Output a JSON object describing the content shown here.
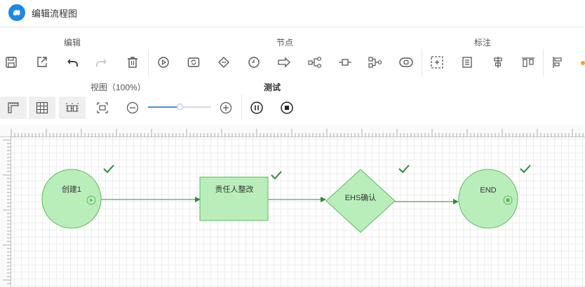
{
  "app": {
    "title": "编辑流程图",
    "accent": "#1e88e5"
  },
  "toolbar": {
    "groups": {
      "edit": "编辑",
      "node": "节点",
      "annotate": "标注"
    },
    "buttons": [
      {
        "name": "save-button",
        "icon": "save-icon",
        "enabled": true
      },
      {
        "name": "export-button",
        "icon": "export-icon",
        "enabled": true
      },
      {
        "name": "undo-button",
        "icon": "undo-icon",
        "enabled": true
      },
      {
        "name": "redo-button",
        "icon": "redo-icon",
        "enabled": false
      },
      {
        "name": "delete-button",
        "icon": "trash-icon",
        "enabled": true
      },
      {
        "name": "start-node-button",
        "icon": "play-circle-icon",
        "enabled": true
      },
      {
        "name": "loop-node-button",
        "icon": "loop-icon",
        "enabled": true
      },
      {
        "name": "decision-node-button",
        "icon": "diamond-icon",
        "enabled": true
      },
      {
        "name": "timer-node-button",
        "icon": "clock-icon",
        "enabled": true
      },
      {
        "name": "arrow-node-button",
        "icon": "arrow-right-icon",
        "enabled": true
      },
      {
        "name": "fork-node-button",
        "icon": "fork-icon",
        "enabled": true
      },
      {
        "name": "task-node-button",
        "icon": "task-icon",
        "enabled": true
      },
      {
        "name": "join-node-button",
        "icon": "join-icon",
        "enabled": true
      },
      {
        "name": "end-node-button",
        "icon": "stop-capsule-icon",
        "enabled": true
      },
      {
        "name": "select-area-button",
        "icon": "select-area-icon",
        "enabled": true
      },
      {
        "name": "note-button",
        "icon": "document-icon",
        "enabled": true
      },
      {
        "name": "align-middle-button",
        "icon": "align-middle-icon",
        "enabled": true
      },
      {
        "name": "align-bottom-button",
        "icon": "align-bottom-icon",
        "enabled": true
      },
      {
        "name": "align-left-button",
        "icon": "align-left-icon",
        "enabled": true
      }
    ]
  },
  "view": {
    "label": "视图（100%）",
    "zoom_percent": 100,
    "slider_fraction": 0.5
  },
  "test": {
    "label": "测试"
  },
  "flow": {
    "nodes": [
      {
        "id": "start",
        "label": "创建1",
        "shape": "circle",
        "status": "done",
        "badge": "play-icon"
      },
      {
        "id": "task",
        "label": "责任人整改",
        "shape": "rect",
        "status": "done"
      },
      {
        "id": "decision",
        "label": "EHS确认",
        "shape": "diamond",
        "status": "done"
      },
      {
        "id": "end",
        "label": "END",
        "shape": "circle",
        "status": "done",
        "badge": "stop-icon"
      }
    ],
    "colors": {
      "fill": "#b9eebb",
      "stroke": "#5cb85c",
      "edge": "#2e8b3a",
      "check": "#2e8b3a"
    }
  }
}
